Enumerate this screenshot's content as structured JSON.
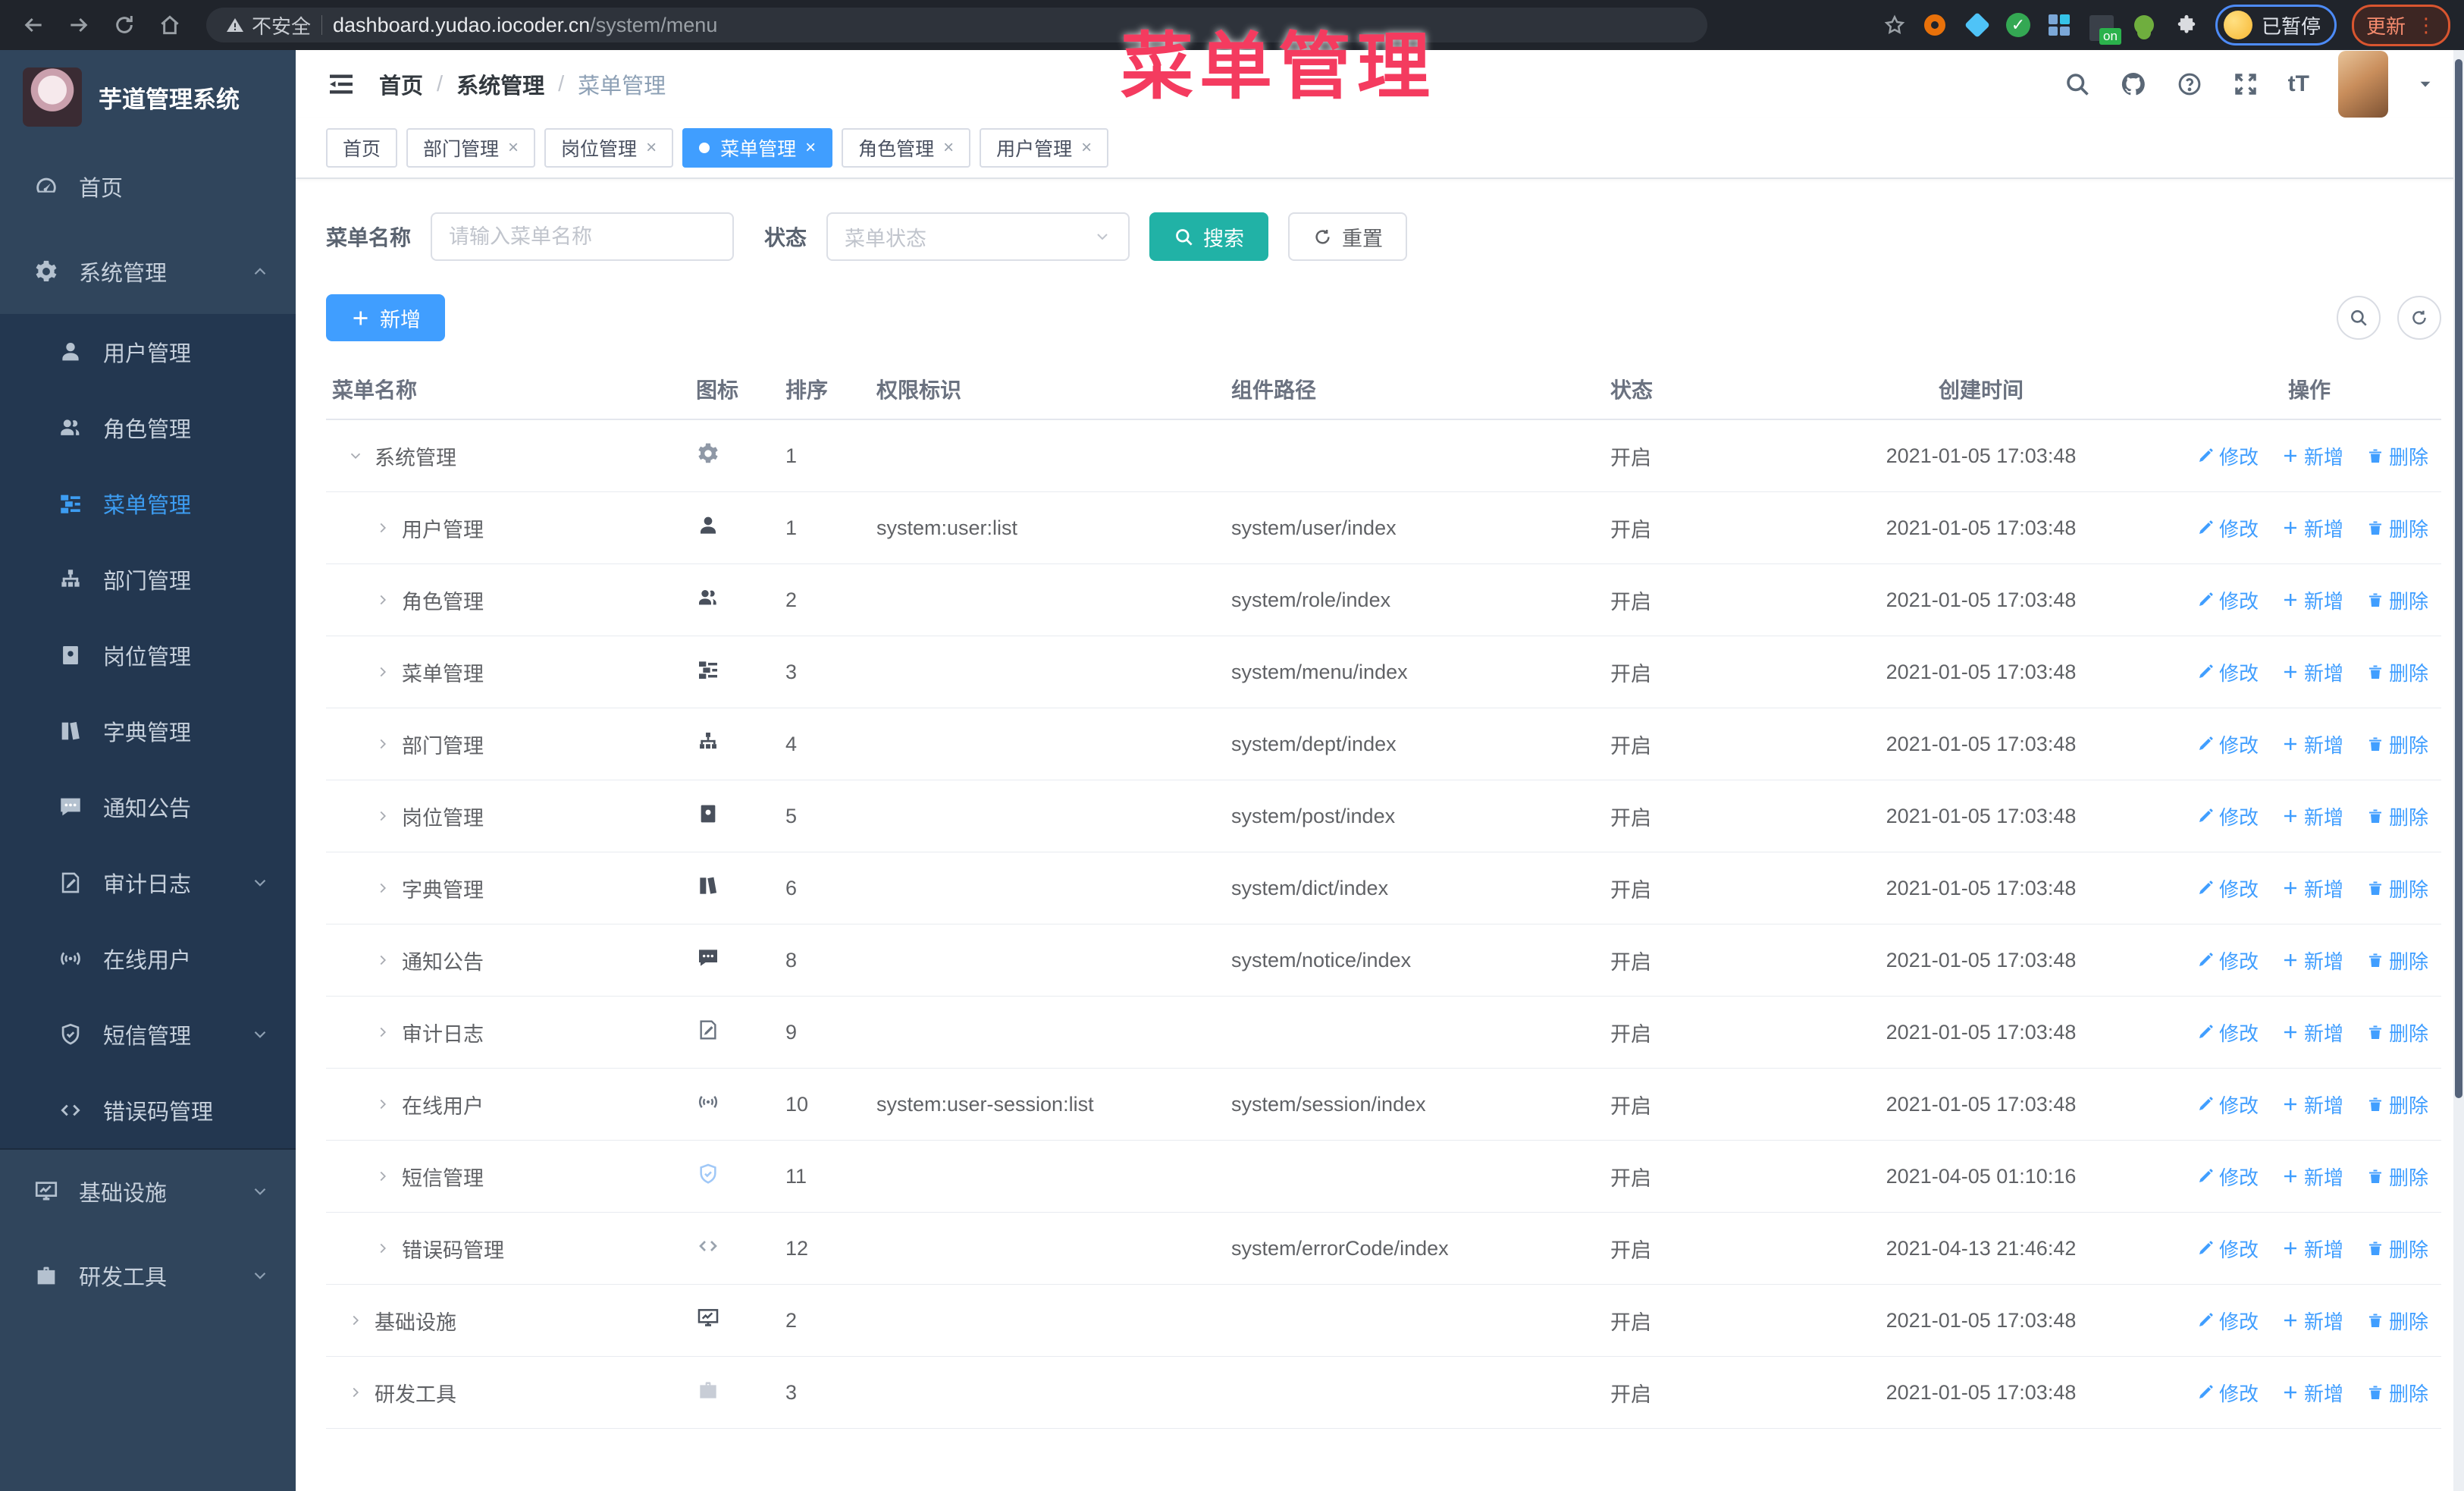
{
  "browser": {
    "security_label": "不安全",
    "url_host": "dashboard.yudao.iocoder.cn",
    "url_path": "/system/menu",
    "ext_on_badge": "on",
    "paused_label": "已暂停",
    "update_label": "更新"
  },
  "watermark": "菜单管理",
  "sidebar": {
    "logo_title": "芋道管理系统",
    "items": [
      {
        "label": "首页",
        "icon": "dashboard-icon",
        "level": 1
      },
      {
        "label": "系统管理",
        "icon": "gear-icon",
        "level": 1,
        "chevron": "up"
      },
      {
        "label": "用户管理",
        "icon": "user-icon",
        "level": 2
      },
      {
        "label": "角色管理",
        "icon": "users-icon",
        "level": 2
      },
      {
        "label": "菜单管理",
        "icon": "tree-table-icon",
        "level": 2,
        "active": true
      },
      {
        "label": "部门管理",
        "icon": "org-tree-icon",
        "level": 2
      },
      {
        "label": "岗位管理",
        "icon": "badge-icon",
        "level": 2
      },
      {
        "label": "字典管理",
        "icon": "books-icon",
        "level": 2
      },
      {
        "label": "通知公告",
        "icon": "chat-icon",
        "level": 2
      },
      {
        "label": "审计日志",
        "icon": "log-icon",
        "level": 2,
        "chevron": "down"
      },
      {
        "label": "在线用户",
        "icon": "online-icon",
        "level": 2
      },
      {
        "label": "短信管理",
        "icon": "shield-icon",
        "level": 2,
        "chevron": "down"
      },
      {
        "label": "错误码管理",
        "icon": "code-icon",
        "level": 2
      },
      {
        "label": "基础设施",
        "icon": "monitor-icon",
        "level": 1,
        "chevron": "down"
      },
      {
        "label": "研发工具",
        "icon": "toolbox-icon",
        "level": 1,
        "chevron": "down"
      }
    ]
  },
  "header": {
    "breadcrumb": [
      "首页",
      "系统管理",
      "菜单管理"
    ]
  },
  "tabs": [
    {
      "label": "首页",
      "closable": false,
      "active": false
    },
    {
      "label": "部门管理",
      "closable": true,
      "active": false
    },
    {
      "label": "岗位管理",
      "closable": true,
      "active": false
    },
    {
      "label": "菜单管理",
      "closable": true,
      "active": true
    },
    {
      "label": "角色管理",
      "closable": true,
      "active": false
    },
    {
      "label": "用户管理",
      "closable": true,
      "active": false
    }
  ],
  "filters": {
    "name_label": "菜单名称",
    "name_placeholder": "请输入菜单名称",
    "status_label": "状态",
    "status_placeholder": "菜单状态",
    "search_label": "搜索",
    "reset_label": "重置",
    "add_label": "新增"
  },
  "table": {
    "columns": [
      "菜单名称",
      "图标",
      "排序",
      "权限标识",
      "组件路径",
      "状态",
      "创建时间",
      "操作"
    ],
    "action_labels": [
      "修改",
      "新增",
      "删除"
    ],
    "rows": [
      {
        "name": "系统管理",
        "level": 1,
        "open": true,
        "icon": "gear-icon",
        "icon_color": "#8f98a6",
        "sort": "1",
        "perm": "",
        "path": "",
        "status": "开启",
        "time": "2021-01-05 17:03:48"
      },
      {
        "name": "用户管理",
        "level": 2,
        "open": false,
        "icon": "user-icon",
        "icon_color": "#49505c",
        "sort": "1",
        "perm": "system:user:list",
        "path": "system/user/index",
        "status": "开启",
        "time": "2021-01-05 17:03:48"
      },
      {
        "name": "角色管理",
        "level": 2,
        "open": false,
        "icon": "users-icon",
        "icon_color": "#49505c",
        "sort": "2",
        "perm": "",
        "path": "system/role/index",
        "status": "开启",
        "time": "2021-01-05 17:03:48"
      },
      {
        "name": "菜单管理",
        "level": 2,
        "open": false,
        "icon": "tree-table-icon",
        "icon_color": "#49505c",
        "sort": "3",
        "perm": "",
        "path": "system/menu/index",
        "status": "开启",
        "time": "2021-01-05 17:03:48"
      },
      {
        "name": "部门管理",
        "level": 2,
        "open": false,
        "icon": "org-tree-icon",
        "icon_color": "#49505c",
        "sort": "4",
        "perm": "",
        "path": "system/dept/index",
        "status": "开启",
        "time": "2021-01-05 17:03:48"
      },
      {
        "name": "岗位管理",
        "level": 2,
        "open": false,
        "icon": "badge-icon",
        "icon_color": "#49505c",
        "sort": "5",
        "perm": "",
        "path": "system/post/index",
        "status": "开启",
        "time": "2021-01-05 17:03:48"
      },
      {
        "name": "字典管理",
        "level": 2,
        "open": false,
        "icon": "books-icon",
        "icon_color": "#49505c",
        "sort": "6",
        "perm": "",
        "path": "system/dict/index",
        "status": "开启",
        "time": "2021-01-05 17:03:48"
      },
      {
        "name": "通知公告",
        "level": 2,
        "open": false,
        "icon": "chat-icon",
        "icon_color": "#49505c",
        "sort": "8",
        "perm": "",
        "path": "system/notice/index",
        "status": "开启",
        "time": "2021-01-05 17:03:48"
      },
      {
        "name": "审计日志",
        "level": 2,
        "open": false,
        "icon": "log-icon",
        "icon_color": "#6a7380",
        "sort": "9",
        "perm": "",
        "path": "",
        "status": "开启",
        "time": "2021-01-05 17:03:48"
      },
      {
        "name": "在线用户",
        "level": 2,
        "open": false,
        "icon": "online-icon",
        "icon_color": "#6a7380",
        "sort": "10",
        "perm": "system:user-session:list",
        "path": "system/session/index",
        "status": "开启",
        "time": "2021-01-05 17:03:48"
      },
      {
        "name": "短信管理",
        "level": 2,
        "open": false,
        "icon": "shield-icon",
        "icon_color": "#a0c8f7",
        "sort": "11",
        "perm": "",
        "path": "",
        "status": "开启",
        "time": "2021-04-05 01:10:16"
      },
      {
        "name": "错误码管理",
        "level": 2,
        "open": false,
        "icon": "code-icon",
        "icon_color": "#9aa3ae",
        "sort": "12",
        "perm": "",
        "path": "system/errorCode/index",
        "status": "开启",
        "time": "2021-04-13 21:46:42"
      },
      {
        "name": "基础设施",
        "level": 1,
        "open": false,
        "icon": "monitor-icon",
        "icon_color": "#49505c",
        "sort": "2",
        "perm": "",
        "path": "",
        "status": "开启",
        "time": "2021-01-05 17:03:48"
      },
      {
        "name": "研发工具",
        "level": 1,
        "open": false,
        "icon": "toolbox-icon",
        "icon_color": "#c8cdd6",
        "sort": "3",
        "perm": "",
        "path": "",
        "status": "开启",
        "time": "2021-01-05 17:03:48"
      }
    ]
  }
}
